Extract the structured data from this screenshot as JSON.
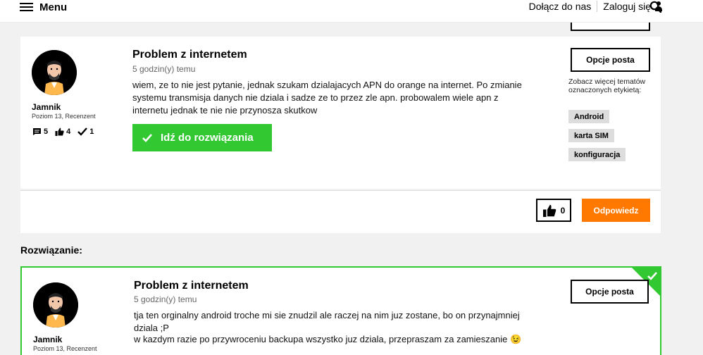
{
  "header": {
    "menu_label": "Menu",
    "join_label": "Dołącz do nas",
    "login_label": "Zaloguj się"
  },
  "post": {
    "title": "Problem z internetem",
    "time": "5 godzin(y) temu",
    "body": "wiem, ze to nie jest pytanie, jednak szukam dzialajacych APN do orange na internet. Po zmianie systemu transmisja danych nie dziala i sadze ze to przez zle apn. probowalem wiele apn z internetu jednak te nie nie przynosza skutkow",
    "author": "Jamnik",
    "rank": "Poziom 13, Recenzent",
    "stats": {
      "messages": "5",
      "kudos": "4",
      "solutions": "1"
    },
    "solution_button": "Idź do rozwiązania",
    "options_button": "Opcje posta",
    "tags_label": "Zobacz więcej tematów oznaczonych etykietą:",
    "tags": [
      "Android",
      "karta SIM",
      "konfiguracja"
    ],
    "kudos_count": "0",
    "reply_button": "Odpowiedz"
  },
  "solution_section": {
    "heading": "Rozwiązanie:"
  },
  "solution_post": {
    "title": "Problem z internetem",
    "time": "5 godzin(y) temu",
    "body_line1": "tja ten orginalny android troche mi sie znudzil ale raczej na nim juz zostane, bo on przynajmniej dziala ;P",
    "body_line2": "w kazdym razie po przywroceniu backupa wszystko juz dziala, przepraszam za zamieszanie 😉",
    "author": "Jamnik",
    "rank": "Poziom 13, Recenzent",
    "options_button": "Opcje posta"
  },
  "colors": {
    "accent_green": "#32c832",
    "accent_orange": "#ff7900",
    "background": "#f1f1f1"
  }
}
